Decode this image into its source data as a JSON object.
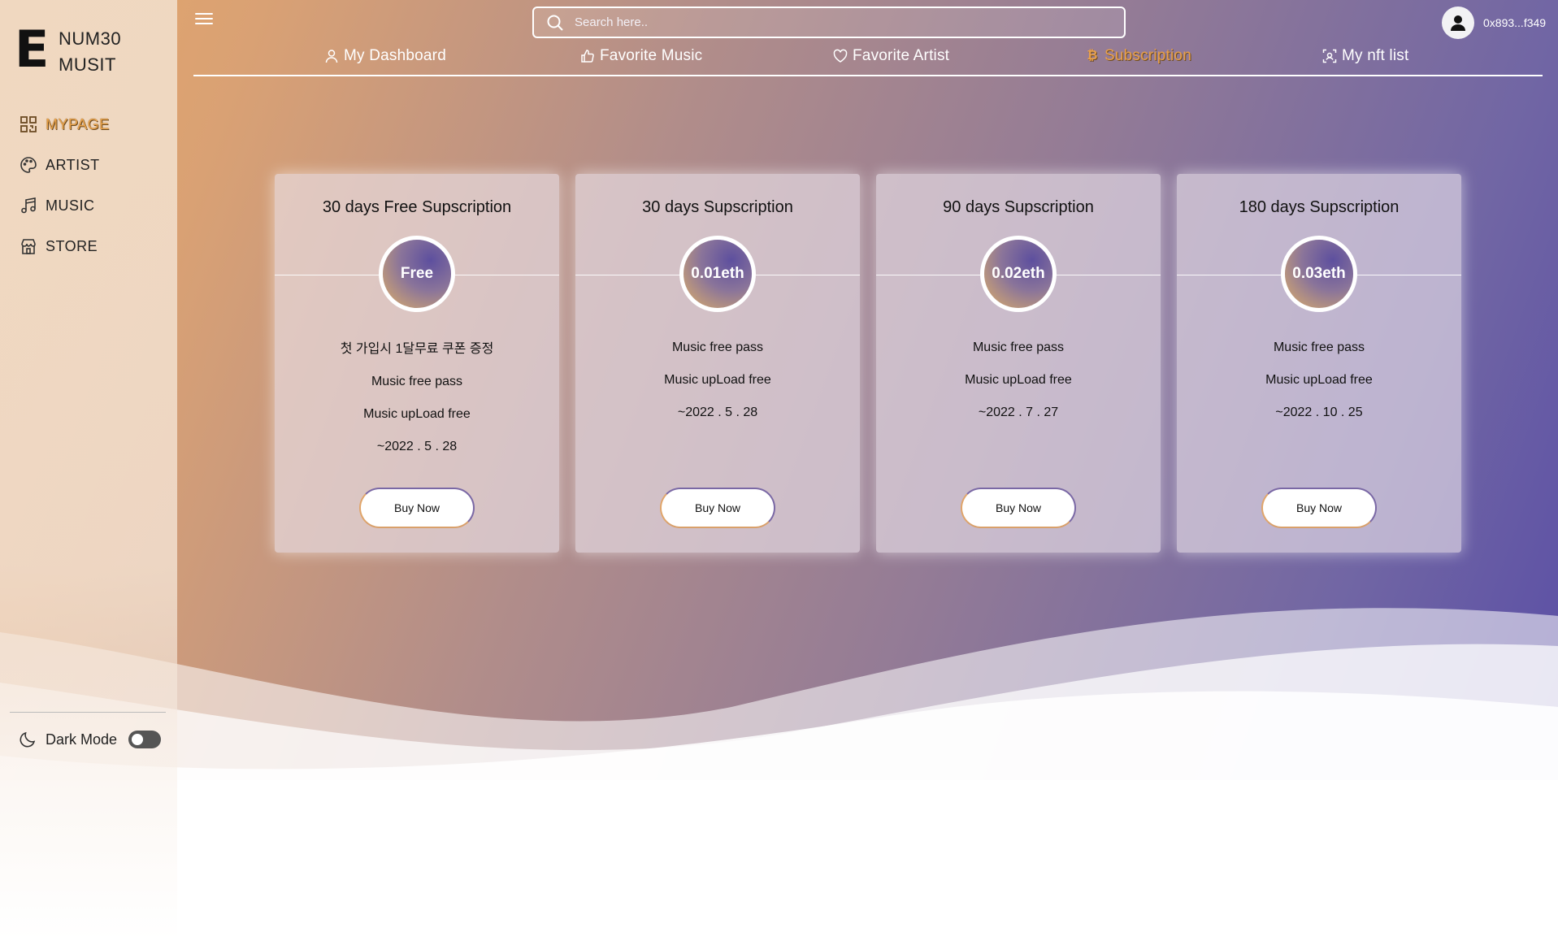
{
  "app": {
    "logo_mark": "E",
    "logo_line1": "NUM30",
    "logo_line2": "MUSIT"
  },
  "sidebar": {
    "items": [
      {
        "label": "MYPAGE",
        "icon": "qr-grid-icon",
        "active": true
      },
      {
        "label": "ARTIST",
        "icon": "palette-icon",
        "active": false
      },
      {
        "label": "MUSIC",
        "icon": "music-note-icon",
        "active": false
      },
      {
        "label": "STORE",
        "icon": "store-icon",
        "active": false
      }
    ],
    "dark_mode_label": "Dark Mode",
    "dark_mode_on": false
  },
  "header": {
    "search_placeholder": "Search here..",
    "user_address": "0x893...f349"
  },
  "tabs": [
    {
      "label": "My Dashboard",
      "icon": "user-icon",
      "active": false
    },
    {
      "label": "Favorite Music",
      "icon": "thumbs-up-icon",
      "active": false
    },
    {
      "label": "Favorite Artist",
      "icon": "heart-icon",
      "active": false
    },
    {
      "label": "Subscription",
      "icon": "bitcoin-icon",
      "active": true
    },
    {
      "label": "My nft list",
      "icon": "scan-icon",
      "active": false
    }
  ],
  "plans": [
    {
      "title": "30 days Free Supscription",
      "price": "Free",
      "features": [
        "첫 가입시 1달무료 쿠폰 증정",
        "Music free pass",
        "Music upLoad free",
        "~2022 . 5 . 28"
      ],
      "button": "Buy Now"
    },
    {
      "title": "30 days Supscription",
      "price": "0.01eth",
      "features": [
        "Music free pass",
        "Music upLoad free",
        "~2022 . 5 . 28"
      ],
      "button": "Buy Now"
    },
    {
      "title": "90 days Supscription",
      "price": "0.02eth",
      "features": [
        "Music free pass",
        "Music upLoad free",
        "~2022 . 7 . 27"
      ],
      "button": "Buy Now"
    },
    {
      "title": "180 days Supscription",
      "price": "0.03eth",
      "features": [
        "Music free pass",
        "Music upLoad free",
        "~2022 . 10 . 25"
      ],
      "button": "Buy Now"
    }
  ],
  "colors": {
    "accent": "#e8a24a",
    "gradient_start": "#e6a769",
    "gradient_end": "#5549a6"
  }
}
